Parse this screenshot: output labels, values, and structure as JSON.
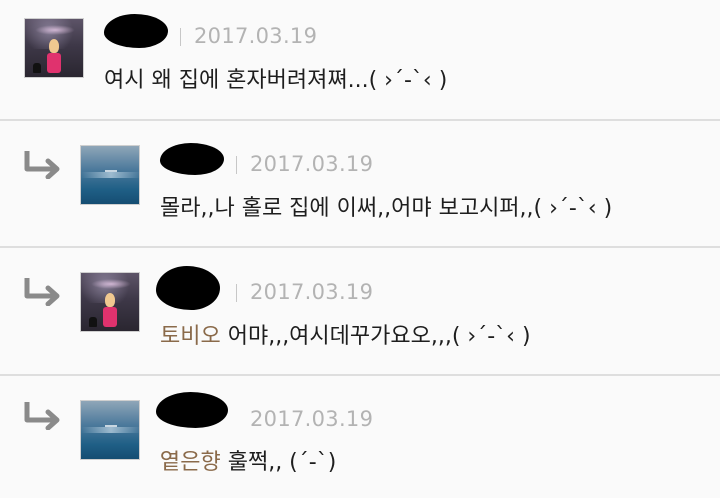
{
  "comments": [
    {
      "date": "2017.03.19",
      "text": "여시 왜 집에 혼자버려져쪄...( ›´-`‹ )",
      "mention": "",
      "is_reply": false,
      "avatar": "art-avatar"
    },
    {
      "date": "2017.03.19",
      "text": "몰라,,나 홀로 집에 이써,,어먀 보고시퍼,,( ›´-`‹ )",
      "mention": "",
      "is_reply": true,
      "avatar": "sea-avatar"
    },
    {
      "date": "2017.03.19",
      "text": " 어먀,,,여시데꾸가요오,,,( ›´-`‹ )",
      "mention": "토비오",
      "is_reply": true,
      "avatar": "art-avatar"
    },
    {
      "date": "2017.03.19",
      "text": " 훌쩍,, (´-`)",
      "mention": "옅은향",
      "is_reply": true,
      "avatar": "sea-avatar"
    }
  ],
  "icons": {
    "reply": "reply-arrow-icon"
  },
  "colors": {
    "mention": "#8a6a4a",
    "date": "#b3b3b3",
    "divider": "#dedede"
  }
}
